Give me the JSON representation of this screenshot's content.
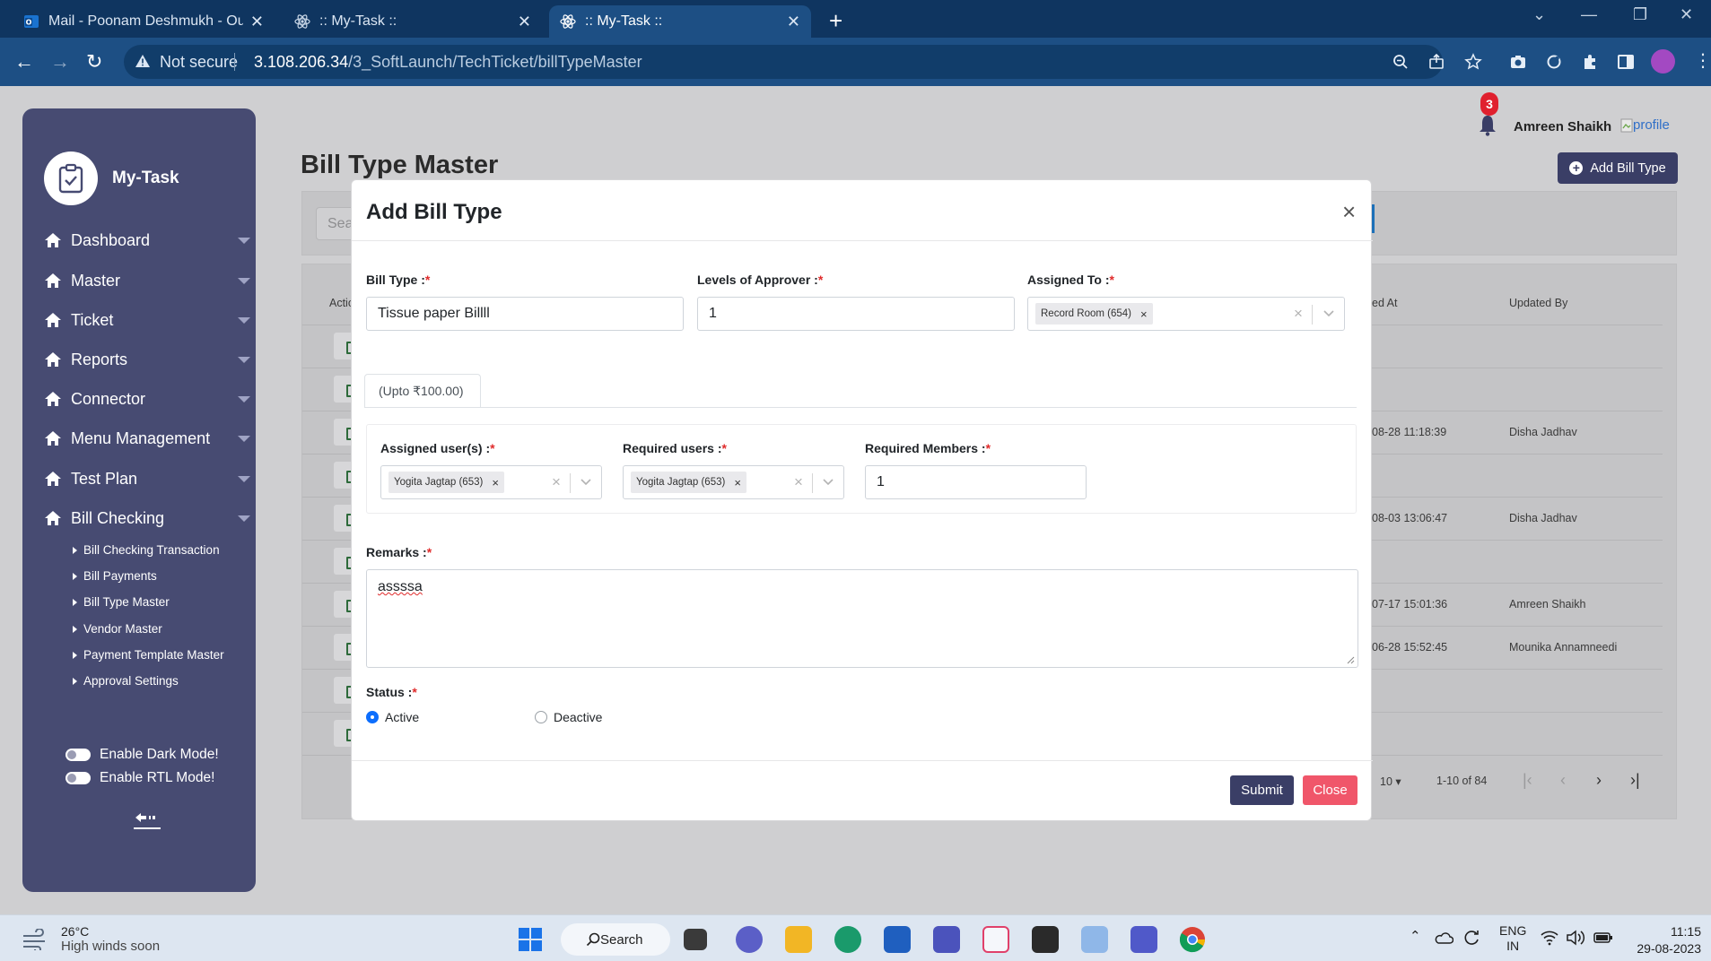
{
  "browser": {
    "tabs": [
      {
        "title": "Mail - Poonam Deshmukh - Outlo",
        "close": "✕"
      },
      {
        "title": ":: My-Task ::",
        "close": "✕"
      },
      {
        "title": ":: My-Task ::",
        "close": "✕"
      }
    ],
    "not_secure": "Not secure",
    "url_host": "3.108.206.34",
    "url_path": "/3_SoftLaunch/TechTicket/billTypeMaster"
  },
  "sidebar": {
    "brand": "My-Task",
    "items": [
      {
        "label": "Dashboard"
      },
      {
        "label": "Master"
      },
      {
        "label": "Ticket"
      },
      {
        "label": "Reports"
      },
      {
        "label": "Connector"
      },
      {
        "label": "Menu Management"
      },
      {
        "label": "Test Plan"
      },
      {
        "label": "Bill Checking"
      }
    ],
    "subitems": [
      {
        "label": "Bill Checking Transaction"
      },
      {
        "label": "Bill Payments"
      },
      {
        "label": "Bill Type Master"
      },
      {
        "label": "Vendor Master"
      },
      {
        "label": "Payment Template Master"
      },
      {
        "label": "Approval Settings"
      }
    ],
    "dark_mode": "Enable Dark Mode!",
    "rtl_mode": "Enable RTL Mode!"
  },
  "page": {
    "title": "Bill Type Master",
    "notification_count": "3",
    "user_name": "Amreen Shaikh",
    "profile_alt": "profile",
    "add_button": "Add Bill Type",
    "search_placeholder": "Sea",
    "col_action": "Actio",
    "col_updated_at": "ed At",
    "col_updated_by": "Updated By",
    "rows": [
      {
        "updated_at": "08-28 11:18:39",
        "updated_by": "Disha Jadhav"
      },
      {
        "updated_at": "08-03 13:06:47",
        "updated_by": "Disha Jadhav"
      },
      {
        "updated_at": "07-17 15:01:36",
        "updated_by": "Amreen Shaikh"
      },
      {
        "updated_at": "06-28 15:52:45",
        "updated_by": "Mounika Annamneedi"
      }
    ],
    "page_size": "10",
    "page_info": "1-10 of 84"
  },
  "modal": {
    "title": "Add Bill Type",
    "bill_type_label": "Bill Type :",
    "bill_type_value": "Tissue paper Billll",
    "levels_label": "Levels of Approver :",
    "levels_value": "1",
    "assigned_to_label": "Assigned To :",
    "assigned_to_chip": "Record Room (654)",
    "level_tab": "(Upto ₹100.00)",
    "assigned_users_label": "Assigned user(s) :",
    "assigned_users_chip": "Yogita Jagtap (653)",
    "required_users_label": "Required users :",
    "required_users_chip": "Yogita Jagtap (653)",
    "required_members_label": "Required Members :",
    "required_members_value": "1",
    "remarks_label": "Remarks :",
    "remarks_value": "assssa",
    "status_label": "Status :",
    "status_active": "Active",
    "status_deactive": "Deactive",
    "status_selected": "Active",
    "required_mark": "*",
    "submit": "Submit",
    "close": "Close"
  },
  "taskbar": {
    "temp": "26°C",
    "weather": "High winds soon",
    "search": "Search",
    "lang1": "ENG",
    "lang2": "IN",
    "time": "11:15",
    "date": "29-08-2023"
  }
}
